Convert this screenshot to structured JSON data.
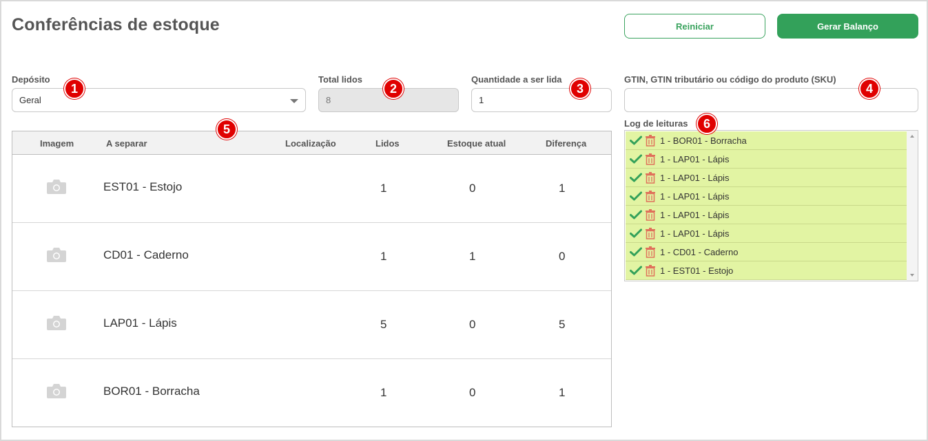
{
  "page": {
    "title": "Conferências de estoque"
  },
  "actions": {
    "reset_label": "Reiniciar",
    "generate_label": "Gerar Balanço"
  },
  "form": {
    "deposit": {
      "label": "Depósito",
      "value": "Geral"
    },
    "total_read": {
      "label": "Total lidos",
      "value": "8"
    },
    "quantity": {
      "label": "Quantidade a ser lida",
      "value": "1"
    },
    "gtin": {
      "label": "GTIN, GTIN tributário ou código do produto (SKU)",
      "value": ""
    }
  },
  "badges": [
    "1",
    "2",
    "3",
    "4",
    "5",
    "6"
  ],
  "table": {
    "headers": {
      "image": "Imagem",
      "to_separate": "A separar",
      "location": "Localização",
      "read": "Lidos",
      "stock": "Estoque atual",
      "diff": "Diferença"
    },
    "rows": [
      {
        "product": "EST01 -  Estojo",
        "location": "",
        "read": "1",
        "stock": "0",
        "diff": "1"
      },
      {
        "product": "CD01 -  Caderno",
        "location": "",
        "read": "1",
        "stock": "1",
        "diff": "0"
      },
      {
        "product": "LAP01 -  Lápis",
        "location": "",
        "read": "5",
        "stock": "0",
        "diff": "5"
      },
      {
        "product": "BOR01 -  Borracha",
        "location": "",
        "read": "1",
        "stock": "0",
        "diff": "1"
      }
    ]
  },
  "log": {
    "label": "Log de leituras",
    "items": [
      "1 - BOR01 - Borracha",
      "1 - LAP01 - Lápis",
      "1 - LAP01 - Lápis",
      "1 - LAP01 - Lápis",
      "1 - LAP01 - Lápis",
      "1 - LAP01 - Lápis",
      "1 - CD01 - Caderno",
      "1 - EST01 - Estojo"
    ]
  },
  "icons": {
    "row_image": "camera-icon",
    "log_ok": "check-icon",
    "log_delete": "trash-icon"
  },
  "colors": {
    "accent": "#33a15a",
    "badge": "#e00000",
    "log_row": "#e2f4a3",
    "trash": "#e0705a"
  }
}
